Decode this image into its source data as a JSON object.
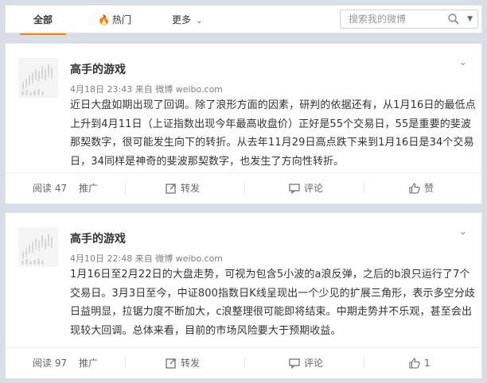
{
  "nav": {
    "tabs": [
      {
        "label": "全部"
      },
      {
        "label": "热门",
        "icon": "flame-icon"
      },
      {
        "label": "更多",
        "icon": "chevron-down-icon"
      }
    ],
    "accent": "#ff8200"
  },
  "search": {
    "placeholder": "搜索我的微博"
  },
  "posts": [
    {
      "author": "高手的游戏",
      "time": "4月18日 23:43",
      "source": "来自 微博 weibo.com",
      "text": "近日大盘如期出现了回调。除了浪形方面的因素，研判的依据还有，从1月16日的最低点上升到4月11日（上证指数出现今年最高收盘价）正好是55个交易日，55是重要的斐波那契数字，很可能发生向下的转折。从去年11月29日高点跌下来到1月16日是34个交易日，34同样是神奇的斐波那契数字，也发生了方向性转折。",
      "read": "阅读 47",
      "promote": "推广",
      "forward": "转发",
      "comment": "评论",
      "like": "赞"
    },
    {
      "author": "高手的游戏",
      "time": "4月10日 22:48",
      "source": "来自 微博 weibo.com",
      "text": "1月16日至2月22日的大盘走势，可视为包含5小波的a浪反弹，之后的b浪只运行了7个交易日。3月3日至今，中证800指数日K线呈现出一个少见的扩展三角形，表示多空分歧日益明显，拉锯力度不断加大，c浪整理很可能即将结束。中期走势并不乐观，甚至会出现较大回调。总体来看，目前的市场风险要大于预期收益。",
      "read": "阅读 97",
      "promote": "推广",
      "forward": "转发",
      "comment": "评论",
      "like": "1"
    }
  ]
}
